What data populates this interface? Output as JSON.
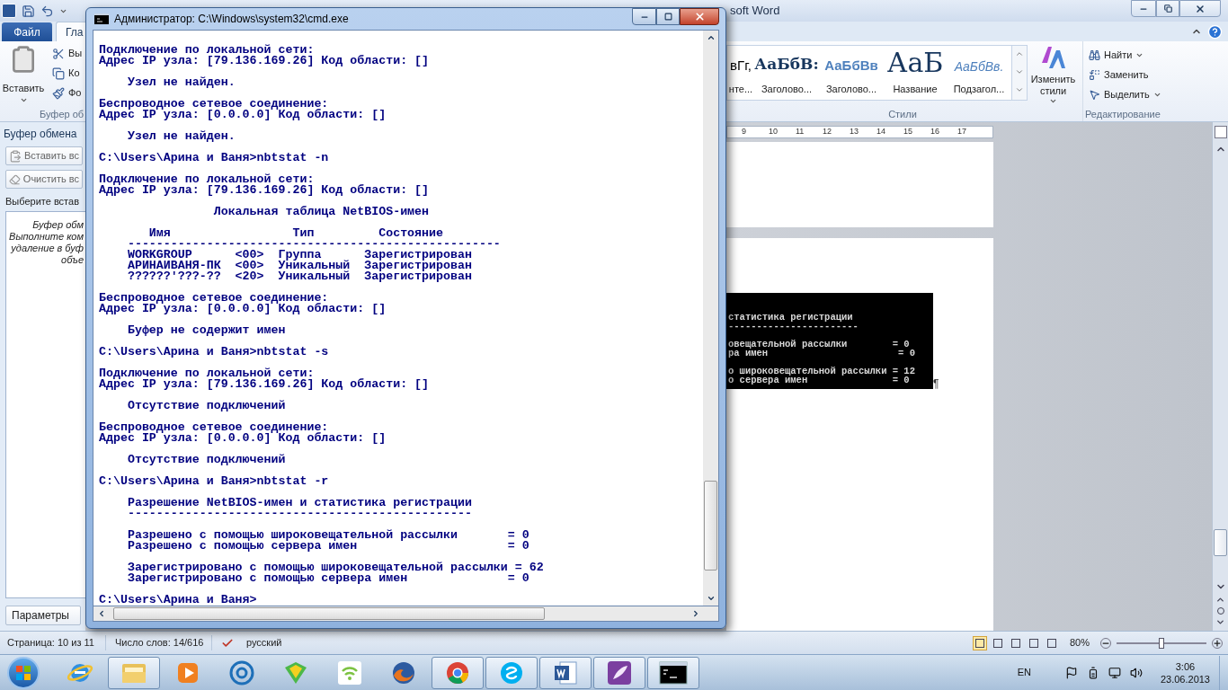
{
  "word": {
    "title": "soft Word",
    "file_button": "Файл",
    "tabs": [
      {
        "label": "Гла",
        "selected": true
      }
    ],
    "clipboard_group": {
      "paste": "Вставить",
      "small_buttons": [
        "Вы",
        "Ко",
        "Фо"
      ],
      "label": "Буфер об"
    },
    "styles_group": {
      "items": [
        {
          "preview": "вГг,",
          "label": "нте..."
        },
        {
          "preview": "АаБбВ:",
          "label": "Заголово..."
        },
        {
          "preview": "АаБбВв",
          "label": "Заголово..."
        },
        {
          "preview": "АаБ",
          "label": "Название"
        },
        {
          "preview": "АаБбВв.",
          "label": "Подзагол..."
        }
      ],
      "change_styles": "Изменить стили",
      "label": "Стили"
    },
    "editing_group": {
      "items": [
        {
          "label": "Найти",
          "dropdown": true
        },
        {
          "label": "Заменить",
          "dropdown": false
        },
        {
          "label": "Выделить",
          "dropdown": true
        }
      ],
      "label": "Редактирование"
    },
    "ruler": [
      "9",
      "10",
      "11",
      "12",
      "13",
      "14",
      "15",
      "16",
      "17"
    ],
    "clipboard_pane": {
      "title": "Буфер обмена",
      "buttons": [
        "Вставить вс",
        "Очистить вс"
      ],
      "prompt": "Выберите встав",
      "message": [
        "Буфер обм",
        "Выполните ком",
        "удаление в буф",
        "объе"
      ],
      "options_button": "Параметры"
    },
    "document": {
      "image_blocks": [
        [
          "статистика регистрации",
          "-----------------------"
        ],
        [
          "овещательной рассылки        = 0",
          "ра имен                       = 0"
        ],
        [
          "о широковещательной рассылки = 12",
          "о сервера имен               = 0"
        ]
      ],
      "pilcrow": "¶"
    },
    "status_bar": {
      "page": "Страница: 10 из 11",
      "words": "Число слов: 14/616",
      "language": "русский",
      "views": [
        {
          "selected": true
        },
        {
          "selected": false
        },
        {
          "selected": false
        },
        {
          "selected": false
        },
        {
          "selected": false
        }
      ],
      "zoom": "80%",
      "zoom_slider": {
        "level": 0.5
      }
    }
  },
  "cmd": {
    "title": "Администратор: C:\\Windows\\system32\\cmd.exe",
    "blocks": [
      [
        "Подключение по локальной сети:",
        "Адрес IP узла: [79.136.169.26] Код области: []"
      ],
      [
        "    Узел не найден."
      ],
      [
        "Беспроводное сетевое соединение:",
        "Адрес IP узла: [0.0.0.0] Код области: []"
      ],
      [
        "    Узел не найден."
      ],
      [
        "C:\\Users\\Арина и Ваня>nbtstat -n"
      ],
      [
        "Подключение по локальной сети:",
        "Адрес IP узла: [79.136.169.26] Код области: []"
      ],
      [
        "                Локальная таблица NetBIOS-имен"
      ],
      [
        "       Имя                 Тип         Состояние",
        "    ----------------------------------------------------",
        "    WORKGROUP      <00>  Группа      Зарегистрирован",
        "    АРИНАИВАНЯ-ПК  <00>  Уникальный  Зарегистрирован",
        "    ??????'???-??  <20>  Уникальный  Зарегистрирован"
      ],
      [
        "Беспроводное сетевое соединение:",
        "Адрес IP узла: [0.0.0.0] Код области: []"
      ],
      [
        "    Буфер не содержит имен"
      ],
      [
        "C:\\Users\\Арина и Ваня>nbtstat -s"
      ],
      [
        "Подключение по локальной сети:",
        "Адрес IP узла: [79.136.169.26] Код области: []"
      ],
      [
        "    Отсутствие подключений"
      ],
      [
        "Беспроводное сетевое соединение:",
        "Адрес IP узла: [0.0.0.0] Код области: []"
      ],
      [
        "    Отсутствие подключений"
      ],
      [
        "C:\\Users\\Арина и Ваня>nbtstat -r"
      ],
      [
        "    Разрешение NetBIOS-имен и статистика регистрации",
        "    ------------------------------------------------"
      ],
      [
        "    Разрешено с помощью широковещательной рассылки       = 0",
        "    Разрешено с помощью сервера имен                     = 0"
      ],
      [
        "    Зарегистрировано с помощью широковещательной рассылки = 62",
        "    Зарегистрировано с помощью сервера имен              = 0"
      ],
      [
        "C:\\Users\\Арина и Ваня>"
      ]
    ]
  },
  "taskbar": {
    "items": [
      {
        "running": false
      },
      {
        "running": true
      },
      {
        "running": false
      },
      {
        "running": false
      },
      {
        "running": false
      },
      {
        "running": false
      },
      {
        "running": false
      },
      {
        "running": true
      },
      {
        "running": true
      },
      {
        "running": true
      },
      {
        "running": true
      },
      {
        "running": true
      }
    ],
    "language": "EN",
    "time": "3:06",
    "date": "23.06.2013"
  }
}
